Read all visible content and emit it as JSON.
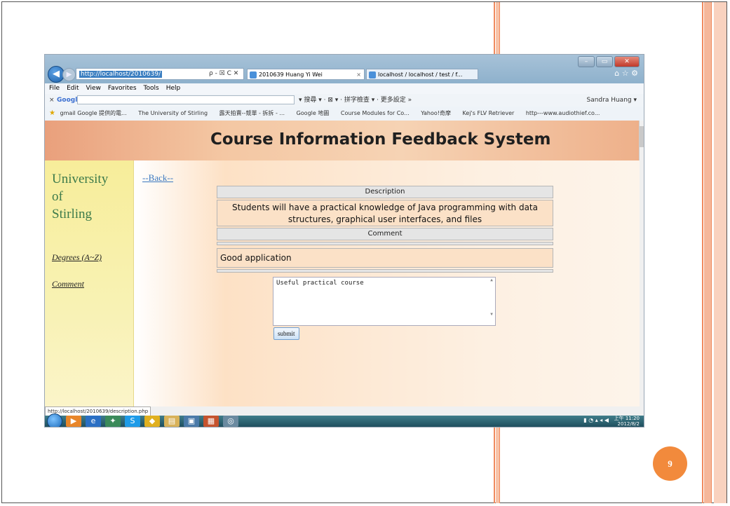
{
  "browser": {
    "address": "http://localhost/2010639/",
    "address_tools": "ρ - ☒ C ✕",
    "tabs": [
      {
        "label": "2010639 Huang Yi Wei"
      },
      {
        "label": "localhost / localhost / test / f..."
      }
    ],
    "menu": [
      "File",
      "Edit",
      "View",
      "Favorites",
      "Tools",
      "Help"
    ],
    "google_label": "Google",
    "google_tools": "▾ 搜尋 ▾ · ⊠ ▾ · 拼字檢查 ▾ · 更多設定 »",
    "user": "Sandra Huang ▾",
    "favorites": [
      "gmail Google 提供的電...",
      "The University of Stirling",
      "露天拍賣--競單 - 拆拆 - ...",
      "Google 地圖",
      "Course Modules for Co...",
      "Yahoo!奇摩",
      "Kej's FLV Retriever",
      "http---www.audiothief.co..."
    ],
    "status_url": "http://localhost/2010639/description.php"
  },
  "site": {
    "title": "Course Information Feedback System",
    "university_lines": [
      "University",
      "of",
      "Stirling"
    ],
    "nav": [
      {
        "label": "Degrees (A~Z)"
      },
      {
        "label": "Comment"
      }
    ],
    "back_label": "--Back--",
    "description_header": "Description",
    "description_text": "Students will have a practical knowledge of Java programming with data structures, graphical user interfaces, and files",
    "comment_header": "Comment",
    "comment_text": "Good application",
    "textarea_value": "Useful practical course",
    "submit_label": "submit"
  },
  "taskbar": {
    "time": "上午 11:20",
    "date": "2012/8/2"
  },
  "slide": {
    "page_number": "9"
  },
  "colors": {
    "accent_stripe": "#f08a5d",
    "page_badge": "#f28a3c",
    "sidebar_text": "#3c7a4a",
    "link": "#3a78c0"
  }
}
